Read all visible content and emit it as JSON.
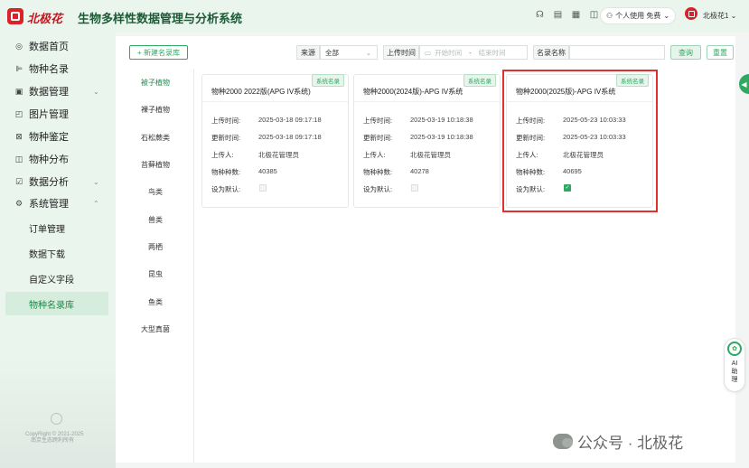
{
  "header": {
    "brand": "北极花",
    "system_title": "生物多样性数据管理与分析系统",
    "icons": [
      "headset-icon",
      "document-icon",
      "qrcode-icon",
      "book-icon"
    ],
    "user_label": "个人使用 免费",
    "org_name": "北极花1"
  },
  "sidebar": {
    "items": [
      {
        "label": "数据首页",
        "icon": "dashboard-icon"
      },
      {
        "label": "物种名录",
        "icon": "list-icon"
      },
      {
        "label": "数据管理",
        "icon": "database-icon",
        "chevron": "⌄"
      },
      {
        "label": "图片管理",
        "icon": "image-icon"
      },
      {
        "label": "物种鉴定",
        "icon": "identify-icon"
      },
      {
        "label": "物种分布",
        "icon": "map-icon"
      },
      {
        "label": "数据分析",
        "icon": "analysis-icon",
        "chevron": "⌄"
      },
      {
        "label": "系统管理",
        "icon": "settings-icon",
        "chevron": "⌃"
      }
    ],
    "sub_items": [
      "订单管理",
      "数据下载",
      "自定义字段",
      "物种名录库"
    ],
    "active_sub": "物种名录库",
    "copyright": "CopyRight © 2021-2025",
    "copyright_line2": "南京生态跨利所有"
  },
  "toolbar": {
    "new_button": "+ 新建名录库",
    "source_label": "来源",
    "source_value": "全部",
    "upload_time_label": "上传时间",
    "start_placeholder": "开始时间",
    "range_sep": "-",
    "end_placeholder": "结束时间",
    "name_label": "名录名称",
    "name_value": "",
    "query_button": "查询",
    "reset_button": "重置"
  },
  "categories": [
    "被子植物",
    "裸子植物",
    "石松蕨类",
    "苔藓植物",
    "鸟类",
    "兽类",
    "两栖",
    "昆虫",
    "鱼类",
    "大型真菌"
  ],
  "active_category": "被子植物",
  "field_labels": {
    "upload_time": "上传时间:",
    "update_time": "更新时间:",
    "uploader": "上传人:",
    "species_count": "物种种数:",
    "set_default": "设为默认:"
  },
  "cards": [
    {
      "tag": "系统名录",
      "title": "物种2000 2022版(APG IV系统)",
      "upload_time": "2025-03-18 09:17:18",
      "update_time": "2025-03-18 09:17:18",
      "uploader": "北极花管理员",
      "species_count": "40385",
      "is_default": false
    },
    {
      "tag": "系统名录",
      "title": "物种2000(2024版)-APG IV系统",
      "upload_time": "2025-03-19 10:18:38",
      "update_time": "2025-03-19 10:18:38",
      "uploader": "北极花管理员",
      "species_count": "40278",
      "is_default": false
    },
    {
      "tag": "系统名录",
      "title": "物种2000(2025版)-APG IV系统",
      "upload_time": "2025-05-23 10:03:33",
      "update_time": "2025-05-23 10:03:33",
      "uploader": "北极花管理员",
      "species_count": "40695",
      "is_default": true
    }
  ],
  "ai_assistant": "AI助理",
  "watermark": "公众号 · 北极花",
  "colors": {
    "accent": "#2fa862",
    "brand_red": "#c3171f",
    "highlight": "#e0312e"
  }
}
